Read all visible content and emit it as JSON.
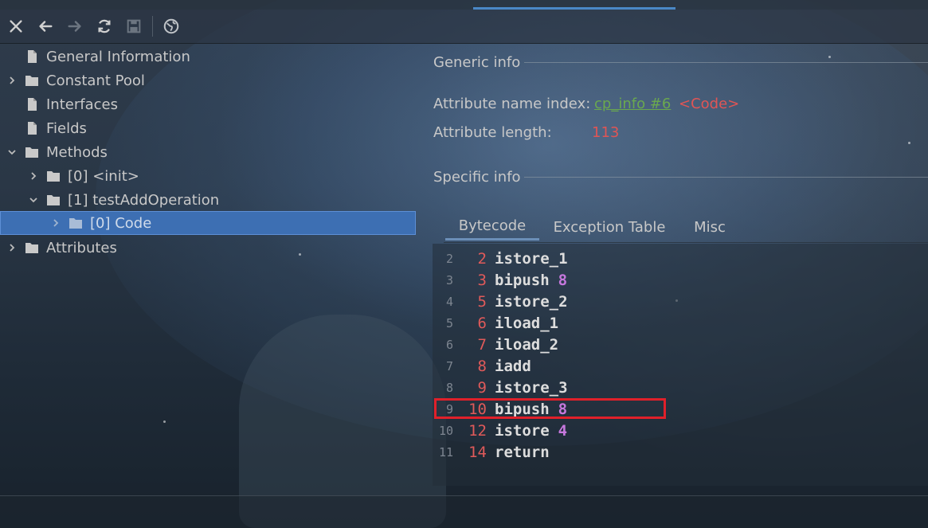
{
  "toolbar": {
    "buttons": [
      {
        "name": "close-button",
        "icon": "close-icon"
      },
      {
        "name": "back-button",
        "icon": "arrow-left-icon"
      },
      {
        "name": "forward-button",
        "icon": "arrow-right-icon"
      },
      {
        "name": "refresh-button",
        "icon": "refresh-icon"
      },
      {
        "name": "save-button",
        "icon": "save-icon"
      },
      {
        "name": "web-button",
        "icon": "globe-icon"
      }
    ]
  },
  "tree": {
    "items": [
      {
        "label": "General Information",
        "icon": "file-icon",
        "expandable": false
      },
      {
        "label": "Constant Pool",
        "icon": "folder-icon",
        "expandable": true,
        "expanded": false
      },
      {
        "label": "Interfaces",
        "icon": "file-icon",
        "expandable": false
      },
      {
        "label": "Fields",
        "icon": "file-icon",
        "expandable": false
      },
      {
        "label": "Methods",
        "icon": "folder-icon",
        "expandable": true,
        "expanded": true
      },
      {
        "label": "[0] <init>",
        "icon": "folder-icon",
        "expandable": true,
        "expanded": false
      },
      {
        "label": "[1] testAddOperation",
        "icon": "folder-icon",
        "expandable": true,
        "expanded": true
      },
      {
        "label": "[0] Code",
        "icon": "folder-icon",
        "expandable": true,
        "expanded": false,
        "selected": true
      },
      {
        "label": "Attributes",
        "icon": "folder-icon",
        "expandable": true,
        "expanded": false
      }
    ]
  },
  "generic": {
    "title": "Generic info",
    "name_index_label": "Attribute name index:",
    "name_index_link": "cp_info #6",
    "name_index_value": "<Code>",
    "length_label": "Attribute length:",
    "length_value": "113"
  },
  "specific": {
    "title": "Specific info"
  },
  "tabs": [
    "Bytecode",
    "Exception Table",
    "Misc"
  ],
  "active_tab": "Bytecode",
  "code": {
    "lines": [
      {
        "ln": "2",
        "off": "2",
        "op": "istore_1",
        "arg": ""
      },
      {
        "ln": "3",
        "off": "3",
        "op": "bipush",
        "arg": "8"
      },
      {
        "ln": "4",
        "off": "5",
        "op": "istore_2",
        "arg": ""
      },
      {
        "ln": "5",
        "off": "6",
        "op": "iload_1",
        "arg": ""
      },
      {
        "ln": "6",
        "off": "7",
        "op": "iload_2",
        "arg": ""
      },
      {
        "ln": "7",
        "off": "8",
        "op": "iadd",
        "arg": ""
      },
      {
        "ln": "8",
        "off": "9",
        "op": "istore_3",
        "arg": ""
      },
      {
        "ln": "9",
        "off": "10",
        "op": "bipush",
        "arg": "8"
      },
      {
        "ln": "10",
        "off": "12",
        "op": "istore",
        "arg": "4"
      },
      {
        "ln": "11",
        "off": "14",
        "op": "return",
        "arg": ""
      }
    ],
    "highlighted_line": 9
  },
  "colors": {
    "selection": "#3d6fb3",
    "offset": "#e05a5a",
    "operand": "#c678dd",
    "link": "#6aa84f",
    "highlight_border": "#e0202a"
  }
}
